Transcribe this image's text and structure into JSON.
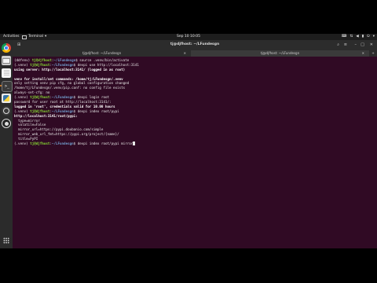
{
  "top_panel": {
    "activities": "Activities",
    "app_menu": "Terminal",
    "clock": "Sep 10  10:05",
    "tray_icons": [
      "keyboard-icon",
      "network-icon",
      "volume-icon",
      "battery-icon",
      "power-icon",
      "menu-arrow-icon"
    ]
  },
  "dock": {
    "items": [
      "chrome-icon",
      "files-icon",
      "text-editor-icon",
      "terminal-icon",
      "python-icon",
      "settings-icon",
      "obs-icon"
    ],
    "grid_icon": "show-applications-icon"
  },
  "window": {
    "title": "tj@djfhost: ~/LFundesgn",
    "tabs": [
      {
        "label": "tj@djfhost: ~/LFundesgn"
      },
      {
        "label": "tj@djfhost: ~/LFundesgn"
      }
    ]
  },
  "terminal": {
    "lines": [
      {
        "prompt": "(ddfenv) tj@djfhost:~/LFundesgn$",
        "cmd": " source .venv/bin/activate"
      },
      {
        "prompt": "(.venv) tj@djfhost:~/LFundesgn$",
        "cmd": " devpi use http://localhost:3141"
      },
      {
        "text": "using server: http://localhost:3141/ (logged in as root)",
        "style": "w"
      },
      {
        "text": ""
      },
      {
        "text": "venv for install/set commands: /home/tj/LFundesgn/.venv",
        "style": "w"
      },
      {
        "text": "only setting venv pip cfg, no global configuration changed"
      },
      {
        "text": "/home/tj/LFundesgn/.venv/pip.conf: no config file exists"
      },
      {
        "text": "always-set-cfg: no"
      },
      {
        "prompt": "(.venv) tj@djfhost:~/LFundesgn$",
        "cmd": " devpi login root"
      },
      {
        "text": "password for user root at http://localhost:3141/:"
      },
      {
        "text": "logged in 'root', credentials valid for 10.00 hours",
        "style": "w"
      },
      {
        "prompt": "(.venv) tj@djfhost:~/LFundesgn$",
        "cmd": " devpi index root/pypi"
      },
      {
        "text": "http://localhost:3141/root/pypi:",
        "style": "w"
      },
      {
        "text": "  type=mirror"
      },
      {
        "text": "  volatile=False"
      },
      {
        "text": "  mirror_url=https://pypi.doubanio.com/simple"
      },
      {
        "text": "  mirror_web_url_fmt=https://pypi.org/project/{name}/"
      },
      {
        "text": "  title=PyPI"
      },
      {
        "prompt": "(.venv) tj@djfhost:~/LFundesgn$",
        "cmd": " devpi index root/pypi mirror",
        "cursor": true
      }
    ]
  }
}
